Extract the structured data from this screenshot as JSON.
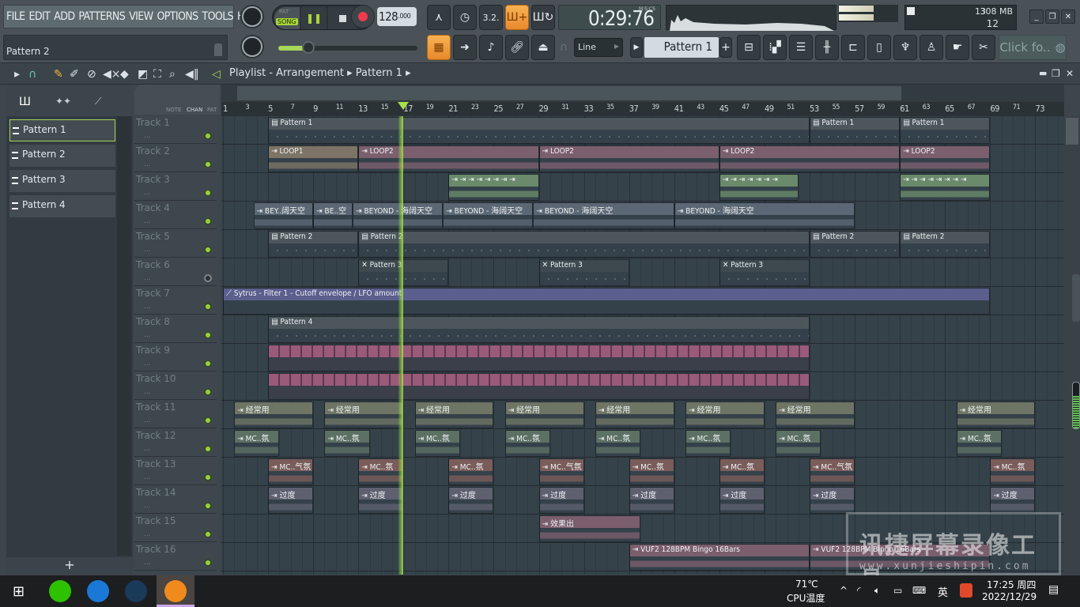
{
  "app": {
    "hint_text": "Pattern 2"
  },
  "menu": [
    "FILE",
    "EDIT",
    "ADD",
    "PATTERNS",
    "VIEW",
    "OPTIONS",
    "TOOLS",
    "HELP"
  ],
  "transport": {
    "pat_label": "PAT",
    "song_label": "SONG",
    "mode": "SONG",
    "tempo_int": "128",
    "tempo_frac": ".000",
    "time": "0:29:76",
    "time_unit": "M:S:CS"
  },
  "cpu": {
    "value": "13",
    "memory": "308 MB",
    "polyphony": "12"
  },
  "toolbar2": {
    "snap": "Line",
    "pattern_selector": "Pattern 1",
    "add_label": "+",
    "news": "Click fo.."
  },
  "playlist": {
    "title": "Playlist - Arrangement",
    "breadcrumb": "Pattern 1",
    "header_labels": [
      "NOTE",
      "CHAN",
      "PAT"
    ]
  },
  "patterns": [
    {
      "name": "Pattern 1",
      "selected": true
    },
    {
      "name": "Pattern 2"
    },
    {
      "name": "Pattern 3"
    },
    {
      "name": "Pattern 4"
    }
  ],
  "ruler": {
    "bars": [
      1,
      3,
      5,
      7,
      9,
      11,
      13,
      15,
      17,
      19,
      21,
      23,
      25,
      27,
      29,
      31,
      33,
      35,
      37,
      39,
      41,
      43,
      45,
      47,
      49,
      51,
      53,
      55,
      57,
      59,
      61,
      63,
      65,
      67,
      69,
      71,
      73
    ],
    "playhead_bar": 17
  },
  "tracks": [
    {
      "name": "Track 1",
      "clips": [
        {
          "label": "Pattern 1",
          "start": 5,
          "end": 53,
          "kind": "pattern"
        },
        {
          "label": "Pattern 1",
          "start": 53,
          "end": 61,
          "kind": "pattern"
        },
        {
          "label": "Pattern 1",
          "start": 61,
          "end": 69,
          "kind": "pattern"
        }
      ]
    },
    {
      "name": "Track 2",
      "clips": [
        {
          "label": "LOOP1",
          "start": 5,
          "end": 13,
          "kind": "loop1"
        },
        {
          "label": "LOOP2",
          "start": 13,
          "end": 29,
          "kind": "loop2"
        },
        {
          "label": "LOOP2",
          "start": 29,
          "end": 45,
          "kind": "loop2"
        },
        {
          "label": "LOOP2",
          "start": 45,
          "end": 61,
          "kind": "loop2"
        },
        {
          "label": "LOOP2",
          "start": 61,
          "end": 69,
          "kind": "loop2"
        }
      ]
    },
    {
      "name": "Track 3",
      "clips": [
        {
          "label": "⇥ ⇥ ⇥ ⇥ ⇥ ⇥ ⇥ ⇥",
          "start": 21,
          "end": 29,
          "kind": "hits"
        },
        {
          "label": "⇥ ⇥ ⇥ ⇥ ⇥ ⇥ ⇥",
          "start": 45,
          "end": 52,
          "kind": "hits"
        },
        {
          "label": "⇥ ⇥ ⇥ ⇥ ⇥ ⇥ ⇥ ⇥",
          "start": 61,
          "end": 69,
          "kind": "hits"
        }
      ]
    },
    {
      "name": "Track 4",
      "clips": [
        {
          "label": "BEY..阔天空",
          "start": 3.7,
          "end": 9,
          "kind": "audio"
        },
        {
          "label": "BE..空",
          "start": 9,
          "end": 12.5,
          "kind": "audio"
        },
        {
          "label": "BEYOND - 海阔天空",
          "start": 12.5,
          "end": 20.5,
          "kind": "audio"
        },
        {
          "label": "BEYOND - 海阔天空",
          "start": 20.5,
          "end": 28.5,
          "kind": "audio"
        },
        {
          "label": "BEYOND - 海阔天空",
          "start": 28.5,
          "end": 41,
          "kind": "audio"
        },
        {
          "label": "BEYOND - 海阔天空",
          "start": 41,
          "end": 57,
          "kind": "audio"
        }
      ]
    },
    {
      "name": "Track 5",
      "clips": [
        {
          "label": "Pattern 2",
          "start": 5,
          "end": 13,
          "kind": "pattern"
        },
        {
          "label": "Pattern 2",
          "start": 13,
          "end": 53,
          "kind": "pattern"
        },
        {
          "label": "Pattern 2",
          "start": 53,
          "end": 61,
          "kind": "pattern"
        },
        {
          "label": "Pattern 2",
          "start": 61,
          "end": 69,
          "kind": "pattern"
        }
      ]
    },
    {
      "name": "Track 6",
      "muted": true,
      "clips": [
        {
          "label": "Pattern 3",
          "start": 13,
          "end": 21,
          "kind": "muted"
        },
        {
          "label": "Pattern 3",
          "start": 29,
          "end": 37,
          "kind": "muted"
        },
        {
          "label": "Pattern 3",
          "start": 45,
          "end": 53,
          "kind": "muted"
        }
      ]
    },
    {
      "name": "Track 7",
      "clips": [
        {
          "label": "Sytrus - Filter 1 - Cutoff envelope / LFO amount",
          "start": 1,
          "end": 69,
          "kind": "auto"
        }
      ]
    },
    {
      "name": "Track 8",
      "clips": [
        {
          "label": "Pattern 4",
          "start": 5,
          "end": 53,
          "kind": "pattern"
        }
      ]
    },
    {
      "name": "Track 9",
      "clips": [
        {
          "label": "",
          "start": 5,
          "end": 53,
          "kind": "autobank"
        }
      ]
    },
    {
      "name": "Track 10",
      "clips": [
        {
          "label": "",
          "start": 5,
          "end": 53,
          "kind": "autobank"
        }
      ]
    },
    {
      "name": "Track 11",
      "clips": [
        {
          "label": "经常用",
          "start": 2,
          "end": 9,
          "kind": "green"
        },
        {
          "label": "经常用",
          "start": 10,
          "end": 17,
          "kind": "green"
        },
        {
          "label": "经常用",
          "start": 18,
          "end": 25,
          "kind": "green"
        },
        {
          "label": "经常用",
          "start": 26,
          "end": 33,
          "kind": "green"
        },
        {
          "label": "经常用",
          "start": 34,
          "end": 41,
          "kind": "green"
        },
        {
          "label": "经常用",
          "start": 42,
          "end": 49,
          "kind": "green"
        },
        {
          "label": "经常用",
          "start": 50,
          "end": 57,
          "kind": "green"
        },
        {
          "label": "经常用",
          "start": 66,
          "end": 73,
          "kind": "green"
        }
      ]
    },
    {
      "name": "Track 12",
      "clips": [
        {
          "label": "MC..氛",
          "start": 2,
          "end": 6,
          "kind": "green2"
        },
        {
          "label": "MC..氛",
          "start": 10,
          "end": 14,
          "kind": "green2"
        },
        {
          "label": "MC..氛",
          "start": 18,
          "end": 22,
          "kind": "green2"
        },
        {
          "label": "MC..氛",
          "start": 26,
          "end": 30,
          "kind": "green2"
        },
        {
          "label": "MC..氛",
          "start": 34,
          "end": 38,
          "kind": "green2"
        },
        {
          "label": "MC..氛",
          "start": 42,
          "end": 46,
          "kind": "green2"
        },
        {
          "label": "MC..氛",
          "start": 50,
          "end": 54,
          "kind": "green2"
        },
        {
          "label": "MC..氛",
          "start": 66,
          "end": 70,
          "kind": "green2"
        }
      ]
    },
    {
      "name": "Track 13",
      "clips": [
        {
          "label": "MC..气氛",
          "start": 5,
          "end": 9,
          "kind": "brown"
        },
        {
          "label": "MC..氛",
          "start": 13,
          "end": 17,
          "kind": "brown"
        },
        {
          "label": "MC..氛",
          "start": 21,
          "end": 25,
          "kind": "brown"
        },
        {
          "label": "MC..气氛",
          "start": 29,
          "end": 33,
          "kind": "brown"
        },
        {
          "label": "MC..氛",
          "start": 37,
          "end": 41,
          "kind": "brown"
        },
        {
          "label": "MC..氛",
          "start": 45,
          "end": 49,
          "kind": "brown"
        },
        {
          "label": "MC..气氛",
          "start": 53,
          "end": 57,
          "kind": "brown"
        },
        {
          "label": "MC..氛",
          "start": 69,
          "end": 73,
          "kind": "brown"
        }
      ]
    },
    {
      "name": "Track 14",
      "clips": [
        {
          "label": "过度",
          "start": 5,
          "end": 9,
          "kind": "slate"
        },
        {
          "label": "过度",
          "start": 13,
          "end": 17,
          "kind": "slate"
        },
        {
          "label": "过度",
          "start": 21,
          "end": 25,
          "kind": "slate"
        },
        {
          "label": "过度",
          "start": 29,
          "end": 33,
          "kind": "slate"
        },
        {
          "label": "过度",
          "start": 37,
          "end": 41,
          "kind": "slate"
        },
        {
          "label": "过度",
          "start": 45,
          "end": 49,
          "kind": "slate"
        },
        {
          "label": "过度",
          "start": 53,
          "end": 57,
          "kind": "slate"
        },
        {
          "label": "过度",
          "start": 69,
          "end": 73,
          "kind": "slate"
        }
      ]
    },
    {
      "name": "Track 15",
      "clips": [
        {
          "label": "效果出",
          "start": 29,
          "end": 38,
          "kind": "mauve"
        }
      ]
    },
    {
      "name": "Track 16",
      "clips": [
        {
          "label": "VUF2 128BPM Bingo 16Bars",
          "start": 37,
          "end": 53,
          "kind": "mauve"
        },
        {
          "label": "VUF2 128BPM Bingo 16Bars",
          "start": 53,
          "end": 69,
          "kind": "mauve"
        }
      ]
    }
  ],
  "clip_colors": {
    "pattern": "#4c565c",
    "loop1": "#7d7466",
    "loop2": "#7c5f6e",
    "hits": "#6a8a6b",
    "audio": "#5b6774",
    "muted": "#3d484f",
    "auto": "#5b5f8e",
    "autobank": "#9a5a7a",
    "green": "#6e7565",
    "green2": "#5c7064",
    "brown": "#7a5c5a",
    "slate": "#5e6070",
    "mauve": "#7a5e6e"
  },
  "taskbar": {
    "temp": "71℃",
    "temp_label": "CPU温度",
    "ime": "英",
    "time": "17:25 周四",
    "date": "2022/12/29"
  },
  "watermark": {
    "title": "讯捷屏幕录像工具",
    "url": "www.xunjieshipin.com"
  }
}
